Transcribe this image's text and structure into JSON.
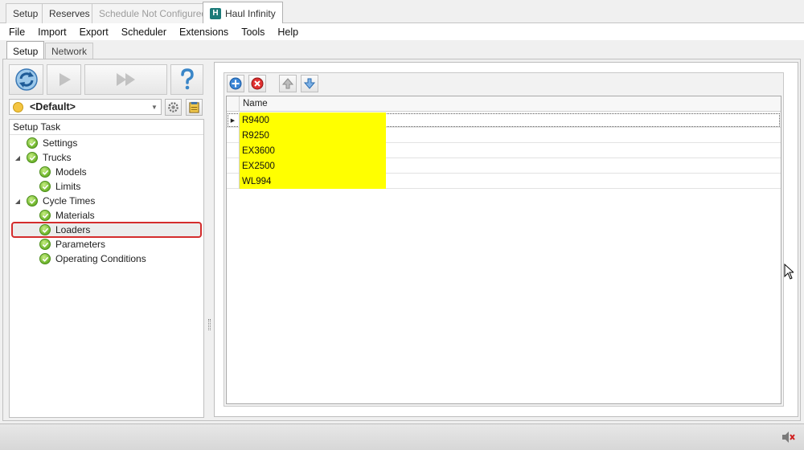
{
  "top_tabs": [
    {
      "label": "Setup",
      "state": "normal"
    },
    {
      "label": "Reserves",
      "state": "normal"
    },
    {
      "label": "Schedule Not Configured",
      "state": "disabled"
    },
    {
      "label": "Haul Infinity",
      "state": "active",
      "icon": "haul-infinity-logo-icon"
    }
  ],
  "menu": [
    "File",
    "Import",
    "Export",
    "Scheduler",
    "Extensions",
    "Tools",
    "Help"
  ],
  "sub_tabs": [
    {
      "label": "Setup",
      "state": "active"
    },
    {
      "label": "Network",
      "state": "normal"
    }
  ],
  "toolbar": {
    "icons": [
      "refresh-icon",
      "play-icon",
      "fast-forward-icon",
      "help-icon"
    ]
  },
  "profile": {
    "selected": "<Default>",
    "icons": [
      "smiley-face-icon",
      "gear-settings-icon",
      "notepad-icon"
    ]
  },
  "tree": {
    "header": "Setup Task",
    "items": [
      {
        "label": "Settings",
        "level": 0,
        "expander": false
      },
      {
        "label": "Trucks",
        "level": 0,
        "expander": true
      },
      {
        "label": "Models",
        "level": 1,
        "expander": false
      },
      {
        "label": "Limits",
        "level": 1,
        "expander": false
      },
      {
        "label": "Cycle Times",
        "level": 0,
        "expander": true
      },
      {
        "label": "Materials",
        "level": 1,
        "expander": false
      },
      {
        "label": "Loaders",
        "level": 1,
        "expander": false,
        "selected": true
      },
      {
        "label": "Parameters",
        "level": 1,
        "expander": false
      },
      {
        "label": "Operating Conditions",
        "level": 1,
        "expander": false
      }
    ]
  },
  "grid_toolbar": {
    "icons": [
      "add-icon",
      "delete-icon",
      "move-up-icon",
      "move-down-icon"
    ]
  },
  "grid": {
    "columns": [
      "Name"
    ],
    "rows": [
      "R9400",
      "R9250",
      "EX3600",
      "EX2500",
      "WL994"
    ],
    "focused_row": 0,
    "highlight_color": "#ffff00"
  },
  "status_bar": {
    "icons": [
      "speaker-muted-icon"
    ]
  },
  "colors": {
    "selection_border": "#d42c2c",
    "check_green": "#6cb32a",
    "brand_teal": "#1b7a78"
  }
}
